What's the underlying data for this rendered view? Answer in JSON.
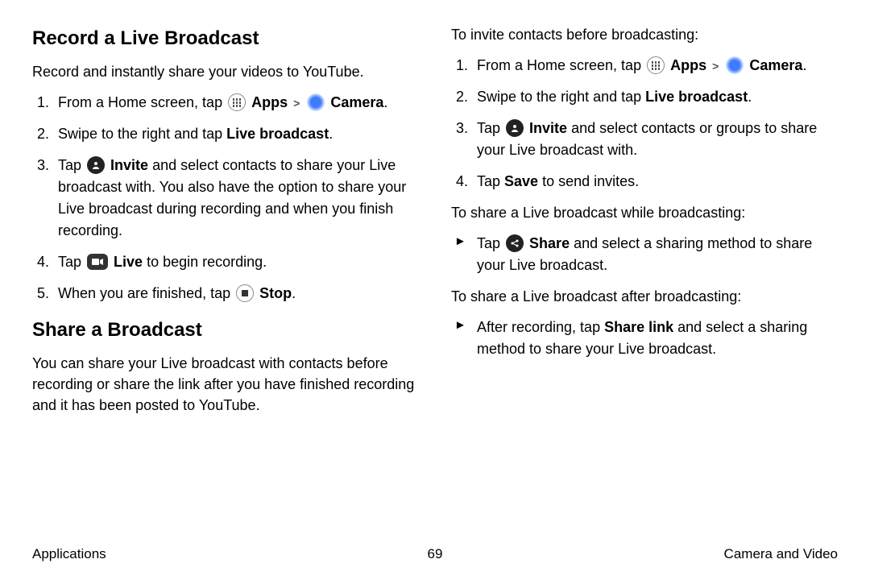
{
  "left": {
    "heading1": "Record a Live Broadcast",
    "intro1": "Record and instantly share your videos to YouTube.",
    "steps1": {
      "s1_pre": "From a Home screen, tap ",
      "s1_apps": "Apps",
      "s1_camera": "Camera",
      "s1_post": ".",
      "s2_pre": "Swipe to the right and tap ",
      "s2_bold": "Live broadcast",
      "s2_post": ".",
      "s3_pre": "Tap ",
      "s3_bold": "Invite",
      "s3_post": " and select contacts to share your Live broadcast with. You also have the option to share your Live broadcast during recording and when you finish recording.",
      "s4_pre": "Tap ",
      "s4_bold": "Live",
      "s4_post": " to begin recording.",
      "s5_pre": "When you are finished, tap ",
      "s5_bold": "Stop",
      "s5_post": "."
    },
    "heading2": "Share a Broadcast",
    "intro2": "You can share your Live broadcast with contacts before recording or share the link after you have finished recording and it has been posted to YouTube."
  },
  "right": {
    "intro1": "To invite contacts before broadcasting:",
    "steps1": {
      "s1_pre": "From a Home screen, tap ",
      "s1_apps": "Apps",
      "s1_camera": "Camera",
      "s1_post": ".",
      "s2_pre": "Swipe to the right and tap ",
      "s2_bold": "Live broadcast",
      "s2_post": ".",
      "s3_pre": "Tap ",
      "s3_bold": "Invite",
      "s3_post": " and select contacts or groups to share your Live broadcast with.",
      "s4_pre": "Tap ",
      "s4_bold": "Save",
      "s4_post": " to send invites."
    },
    "intro2": "To share a Live broadcast while broadcasting:",
    "arrow1": {
      "pre": "Tap ",
      "bold": "Share",
      "post": " and select a sharing method to share your Live broadcast."
    },
    "intro3": "To share a Live broadcast after broadcasting:",
    "arrow2": {
      "pre": "After recording, tap ",
      "bold": "Share link",
      "post": " and select a sharing method to share your Live broadcast."
    }
  },
  "footer": {
    "left": "Applications",
    "center": "69",
    "right": "Camera and Video"
  },
  "glyphs": {
    "chevron": ">"
  }
}
